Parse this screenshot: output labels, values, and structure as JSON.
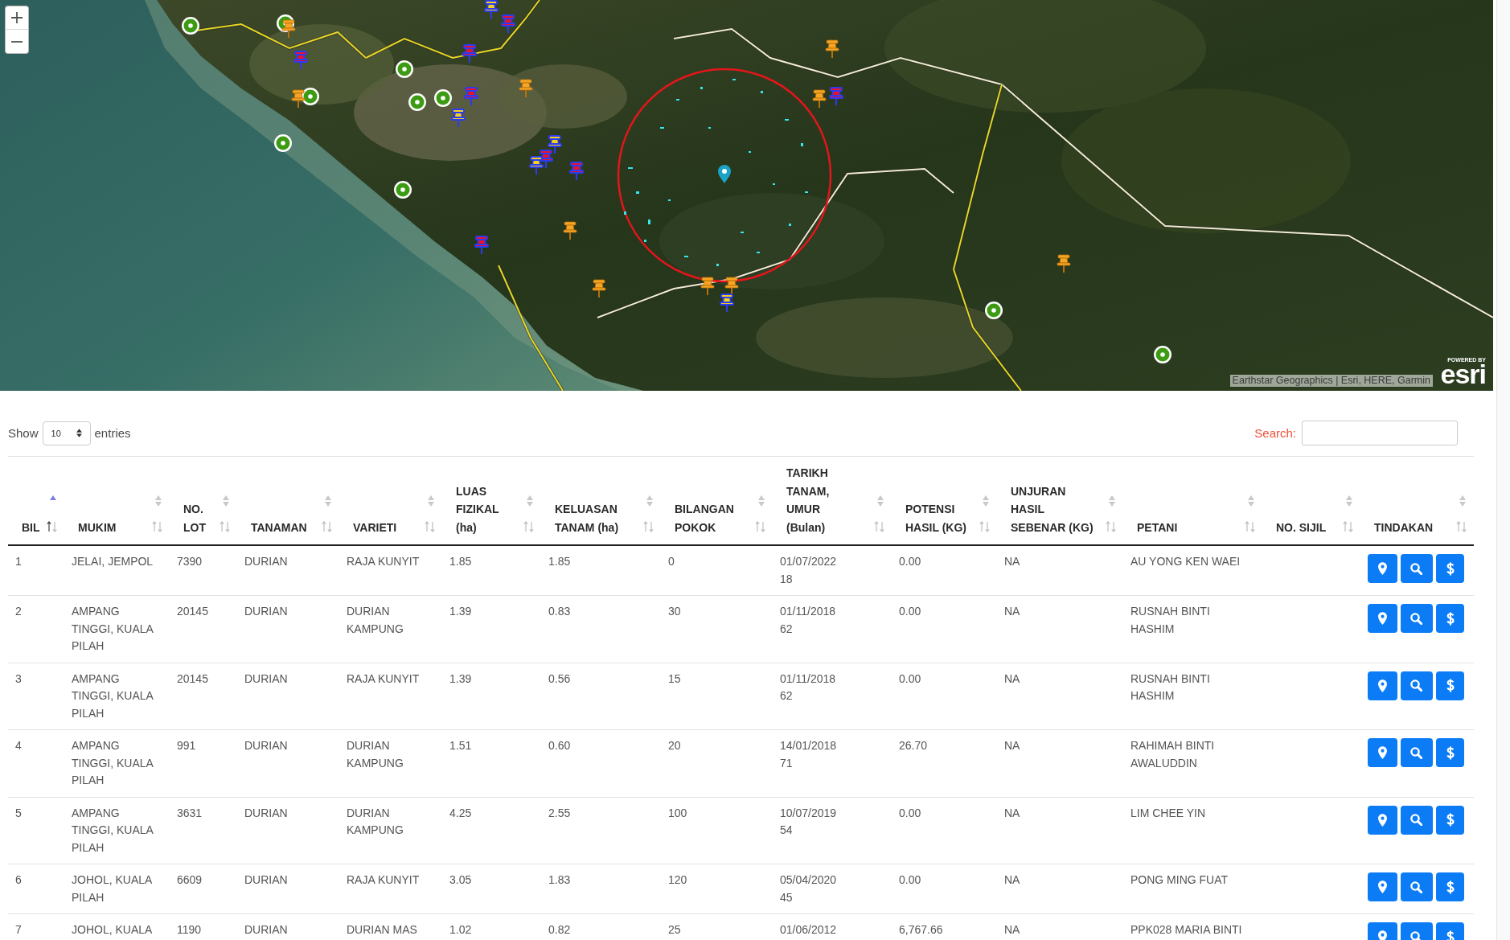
{
  "map": {
    "attribution": "Earthstar Geographics | Esri, HERE, Garmin",
    "logo": {
      "caption": "POWERED BY",
      "wordmark": "esri"
    }
  },
  "length_menu": {
    "prefix": "Show",
    "value": "10",
    "suffix": "entries"
  },
  "search": {
    "label": "Search:"
  },
  "table": {
    "columns": [
      {
        "label": "BIL",
        "sorted": true
      },
      {
        "label": "MUKIM",
        "sorted": false
      },
      {
        "label": "NO. LOT",
        "sorted": false
      },
      {
        "label": "TANAMAN",
        "sorted": false
      },
      {
        "label": "VARIETI",
        "sorted": false
      },
      {
        "label": "LUAS FIZIKAL (ha)",
        "sorted": false
      },
      {
        "label": "KELUASAN TANAM (ha)",
        "sorted": false
      },
      {
        "label": "BILANGAN POKOK",
        "sorted": false
      },
      {
        "label": "TARIKH TANAM, UMUR (Bulan)",
        "sorted": false
      },
      {
        "label": "POTENSI HASIL (KG)",
        "sorted": false
      },
      {
        "label": "UNJURAN HASIL SEBENAR (KG)",
        "sorted": false
      },
      {
        "label": "PETANI",
        "sorted": false
      },
      {
        "label": "NO. SIJIL",
        "sorted": false
      },
      {
        "label": "TINDAKAN",
        "sorted": false
      }
    ],
    "rows": [
      {
        "bil": "1",
        "mukim": "JELAI, JEMPOL",
        "no_lot": "7390",
        "tanaman": "DURIAN",
        "varieti": "RAJA KUNYIT",
        "luas_fizikal": "1.85",
        "keluasan_tanam": "1.85",
        "bilangan_pokok": "0",
        "tarikh_tanam": "01/07/2022",
        "umur": "18",
        "potensi_hasil": "0.00",
        "unjuran_hasil": "NA",
        "petani": "AU YONG KEN WAEI",
        "actions": [
          {
            "kind": "pin"
          },
          {
            "kind": "search"
          },
          {
            "kind": "dollar"
          }
        ]
      },
      {
        "bil": "2",
        "mukim": "AMPANG TINGGI, KUALA PILAH",
        "no_lot": "20145",
        "tanaman": "DURIAN",
        "varieti": "DURIAN KAMPUNG",
        "luas_fizikal": "1.39",
        "keluasan_tanam": "0.83",
        "bilangan_pokok": "30",
        "tarikh_tanam": "01/11/2018",
        "umur": "62",
        "potensi_hasil": "0.00",
        "unjuran_hasil": "NA",
        "petani": "RUSNAH BINTI HASHIM",
        "actions": [
          {
            "kind": "pin"
          },
          {
            "kind": "search"
          },
          {
            "kind": "dollar"
          }
        ]
      },
      {
        "bil": "3",
        "mukim": "AMPANG TINGGI, KUALA PILAH",
        "no_lot": "20145",
        "tanaman": "DURIAN",
        "varieti": "RAJA KUNYIT",
        "luas_fizikal": "1.39",
        "keluasan_tanam": "0.56",
        "bilangan_pokok": "15",
        "tarikh_tanam": "01/11/2018",
        "umur": "62",
        "potensi_hasil": "0.00",
        "unjuran_hasil": "NA",
        "petani": "RUSNAH BINTI HASHIM",
        "actions": [
          {
            "kind": "pin"
          },
          {
            "kind": "search"
          },
          {
            "kind": "dollar"
          }
        ]
      },
      {
        "bil": "4",
        "mukim": "AMPANG TINGGI, KUALA PILAH",
        "no_lot": "991",
        "tanaman": "DURIAN",
        "varieti": "DURIAN KAMPUNG",
        "luas_fizikal": "1.51",
        "keluasan_tanam": "0.60",
        "bilangan_pokok": "20",
        "tarikh_tanam": "14/01/2018",
        "umur": "71",
        "potensi_hasil": "26.70",
        "unjuran_hasil": "NA",
        "petani": "RAHIMAH BINTI AWALUDDIN",
        "actions": [
          {
            "kind": "pin"
          },
          {
            "kind": "search"
          },
          {
            "kind": "dollar"
          }
        ]
      },
      {
        "bil": "5",
        "mukim": "AMPANG TINGGI, KUALA PILAH",
        "no_lot": "3631",
        "tanaman": "DURIAN",
        "varieti": "DURIAN KAMPUNG",
        "luas_fizikal": "4.25",
        "keluasan_tanam": "2.55",
        "bilangan_pokok": "100",
        "tarikh_tanam": "10/07/2019",
        "umur": "54",
        "potensi_hasil": "0.00",
        "unjuran_hasil": "NA",
        "petani": "LIM CHEE YIN",
        "actions": [
          {
            "kind": "pin"
          },
          {
            "kind": "search"
          },
          {
            "kind": "dollar"
          }
        ]
      },
      {
        "bil": "6",
        "mukim": "JOHOL, KUALA PILAH",
        "no_lot": "6609",
        "tanaman": "DURIAN",
        "varieti": "RAJA KUNYIT",
        "luas_fizikal": "3.05",
        "keluasan_tanam": "1.83",
        "bilangan_pokok": "120",
        "tarikh_tanam": "05/04/2020",
        "umur": "45",
        "potensi_hasil": "0.00",
        "unjuran_hasil": "NA",
        "petani": "PONG MING FUAT",
        "actions": [
          {
            "kind": "pin"
          },
          {
            "kind": "search"
          },
          {
            "kind": "dollar"
          }
        ]
      },
      {
        "bil": "7",
        "mukim": "JOHOL, KUALA",
        "no_lot": "1190",
        "tanaman": "DURIAN",
        "varieti": "DURIAN MAS",
        "luas_fizikal": "1.02",
        "keluasan_tanam": "0.82",
        "bilangan_pokok": "25",
        "tarikh_tanam": "01/06/2012",
        "potensi_hasil": "6,767.66",
        "unjuran_hasil": "NA",
        "petani": "PPK028 MARIA BINTI",
        "actions": [
          {
            "kind": "pin"
          },
          {
            "kind": "search"
          },
          {
            "kind": "dollar"
          }
        ]
      }
    ]
  }
}
